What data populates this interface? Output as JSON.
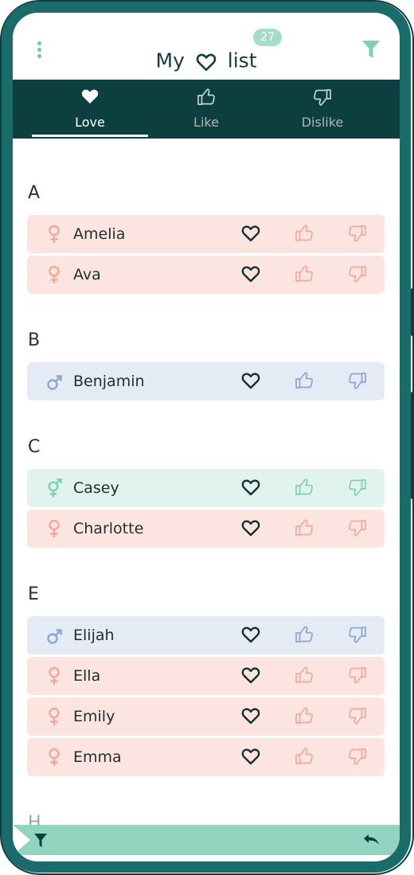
{
  "header": {
    "title_prefix": "My",
    "title_suffix": "list",
    "count_badge": "27",
    "menu_icon": "vertical-dots-icon",
    "filter_icon": "funnel-icon"
  },
  "tabs": [
    {
      "label": "Love",
      "icon": "heart-icon",
      "active": true
    },
    {
      "label": "Like",
      "icon": "thumbs-up-icon",
      "active": false
    },
    {
      "label": "Dislike",
      "icon": "thumbs-down-icon",
      "active": false
    }
  ],
  "sections": [
    {
      "letter": "A",
      "names": [
        {
          "name": "Amelia",
          "gender": "female"
        },
        {
          "name": "Ava",
          "gender": "female"
        }
      ]
    },
    {
      "letter": "B",
      "names": [
        {
          "name": "Benjamin",
          "gender": "male"
        }
      ]
    },
    {
      "letter": "C",
      "names": [
        {
          "name": "Casey",
          "gender": "unisex"
        },
        {
          "name": "Charlotte",
          "gender": "female"
        }
      ]
    },
    {
      "letter": "E",
      "names": [
        {
          "name": "Elijah",
          "gender": "male"
        },
        {
          "name": "Ella",
          "gender": "female"
        },
        {
          "name": "Emily",
          "gender": "female"
        },
        {
          "name": "Emma",
          "gender": "female"
        }
      ]
    },
    {
      "letter": "H",
      "names": []
    }
  ],
  "colors": {
    "teal_dark": "#0e3f40",
    "phone_frame": "#1b6b6b",
    "accent_mint": "#91d5c0",
    "female_bg": "#fce5e1",
    "female_icon": "#f0a89c",
    "male_bg": "#e5ebf4",
    "male_icon": "#8aa6d1",
    "unisex_bg": "#e1f3ee",
    "unisex_icon": "#7fd1b6"
  },
  "bottom_bar": {
    "filter_icon": "funnel-icon",
    "back_icon": "undo-arrow-icon"
  }
}
